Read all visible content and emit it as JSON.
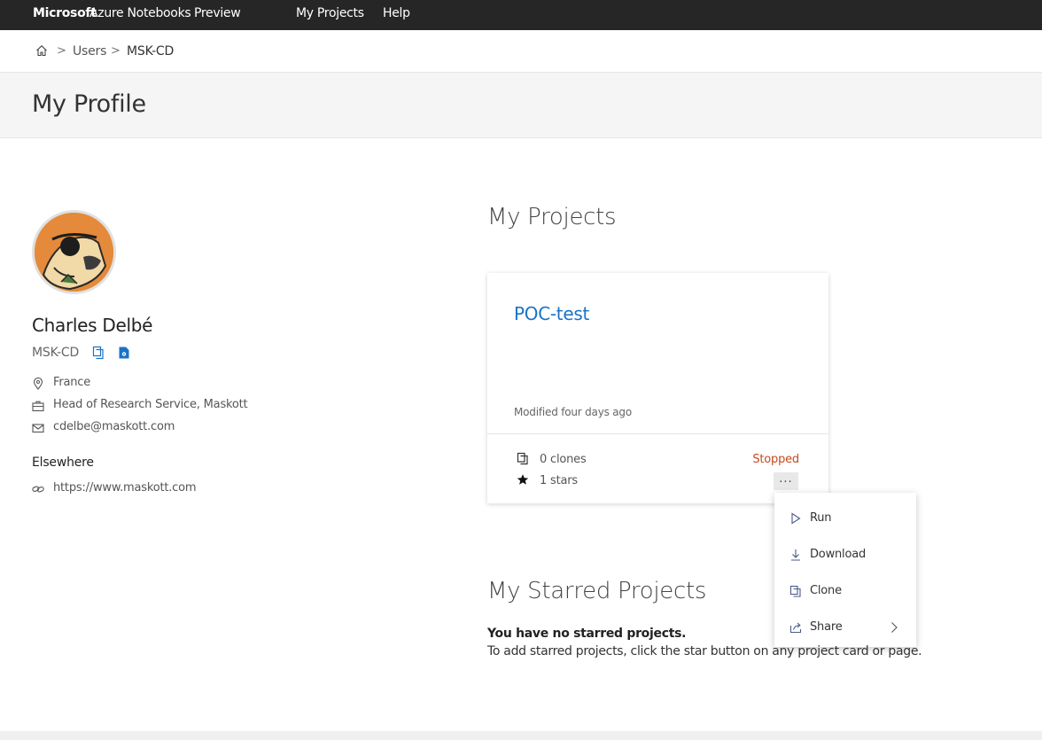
{
  "topbar": {
    "brand_strong": "Microsoft",
    "brand_light": "Azure Notebooks",
    "preview": "Preview",
    "nav": [
      "My Projects",
      "Help"
    ]
  },
  "breadcrumb": {
    "items": [
      "Users",
      "MSK-CD"
    ],
    "separator": ">"
  },
  "page": {
    "title": "My Profile"
  },
  "profile": {
    "name": "Charles Delbé",
    "handle": "MSK-CD",
    "location": "France",
    "job": "Head of Research Service, Maskott",
    "email": "cdelbe@maskott.com",
    "elsewhere_heading": "Elsewhere",
    "website": "https://www.maskott.com"
  },
  "projects": {
    "title": "My Projects",
    "cards": [
      {
        "name": "POC-test",
        "modified": "Modified four days ago",
        "clones": "0 clones",
        "stars": "1 stars",
        "status": "Stopped",
        "more_label": "..."
      }
    ]
  },
  "context_menu": {
    "items": [
      "Run",
      "Download",
      "Clone",
      "Share"
    ]
  },
  "starred": {
    "title": "My Starred Projects",
    "empty_heading": "You have no starred projects.",
    "empty_hint": "To add starred projects, click the star button on any project card or page."
  },
  "colors": {
    "topbar": "#262626",
    "link_blue": "#1a73c7",
    "status_stopped": "#c64a1c"
  }
}
